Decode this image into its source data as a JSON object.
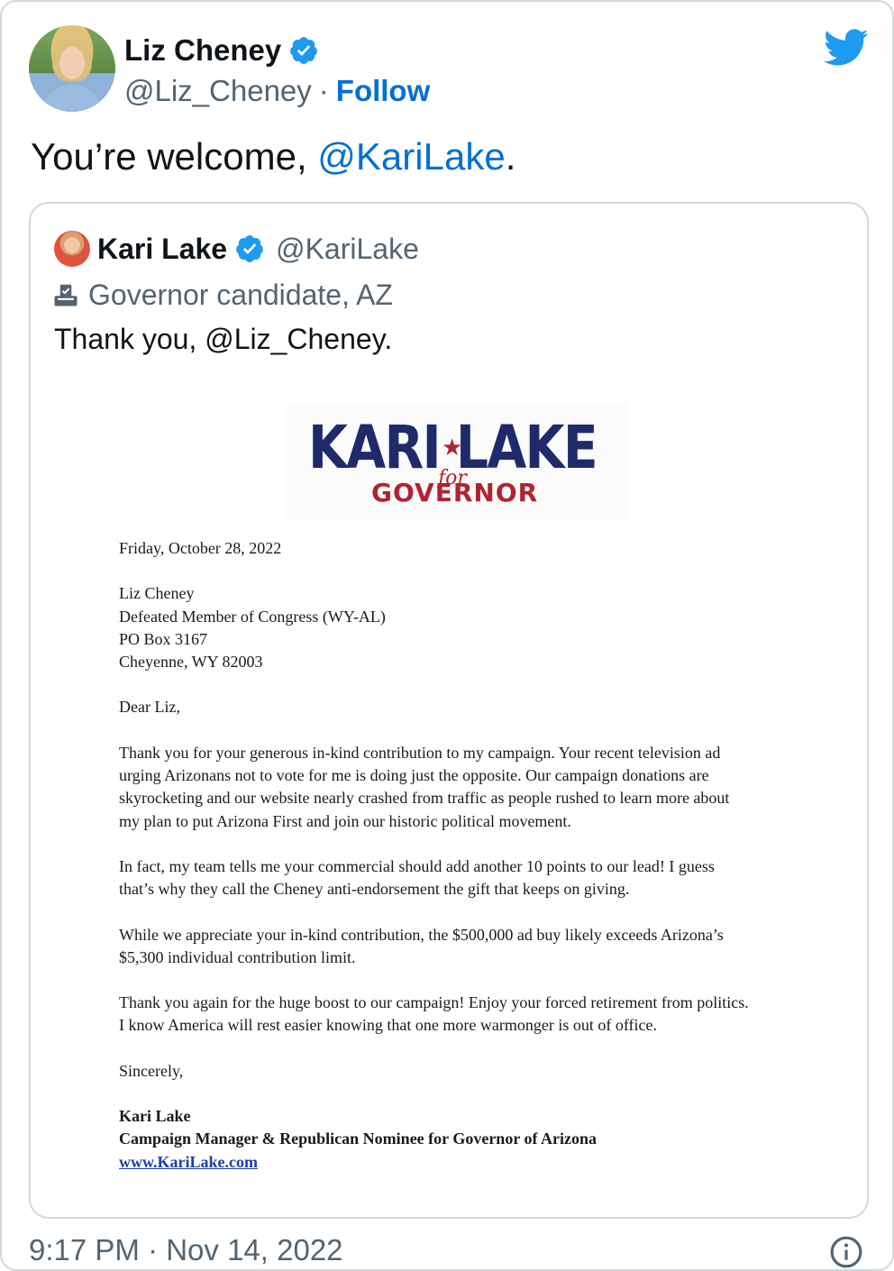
{
  "author": {
    "display_name": "Liz Cheney",
    "handle": "@Liz_Cheney",
    "separator": "·",
    "follow_label": "Follow",
    "verified_icon": "verified-badge-icon",
    "brand_icon": "twitter-bird-icon"
  },
  "tweet": {
    "text_prefix": "You’re welcome, ",
    "mention": "@KariLake",
    "text_suffix": "."
  },
  "quote": {
    "display_name": "Kari Lake",
    "handle": "@KariLake",
    "label_icon": "ballot-box-icon",
    "label": "Governor candidate, AZ",
    "text": "Thank you, @Liz_Cheney."
  },
  "letter": {
    "logo_main": "KARI LAKE",
    "logo_for": "for",
    "logo_sub": "GOVERNOR",
    "date": "Friday, October 28, 2022",
    "address": [
      "Liz Cheney",
      "Defeated Member of Congress (WY-AL)",
      "PO Box 3167",
      "Cheyenne, WY 82003"
    ],
    "salutation": "Dear Liz,",
    "paragraphs": [
      [
        "Thank you for your generous in-kind contribution to my campaign. Your recent television ad",
        "urging Arizonans not to vote for me is doing just the opposite. Our campaign donations are",
        "skyrocketing and our website nearly crashed from traffic as people rushed to learn more about",
        "my plan to put Arizona First and join our historic political movement."
      ],
      [
        "In fact, my team tells me your commercial should add another 10 points to our lead! I guess",
        "that’s why they call the Cheney anti-endorsement the gift that keeps on giving."
      ],
      [
        "While we appreciate your in-kind contribution, the $500,000 ad buy likely exceeds Arizona’s",
        "$5,300 individual contribution limit."
      ],
      [
        "Thank you again for the huge boost to our campaign! Enjoy your forced retirement from politics.",
        "I know America will rest easier knowing that one more warmonger is out of office."
      ]
    ],
    "closing": "Sincerely,",
    "signature_name": "Kari Lake",
    "signature_title": "Campaign Manager & Republican Nominee for Governor of Arizona",
    "signature_link": "www.KariLake.com"
  },
  "footer": {
    "timestamp": "9:17 PM · Nov 14, 2022",
    "info_icon": "info-icon"
  },
  "colors": {
    "link_blue": "#006fd6",
    "verified_blue": "#1d9bf0",
    "secondary_text": "#536471",
    "logo_navy": "#1f2a6b",
    "logo_red": "#b2232f"
  }
}
